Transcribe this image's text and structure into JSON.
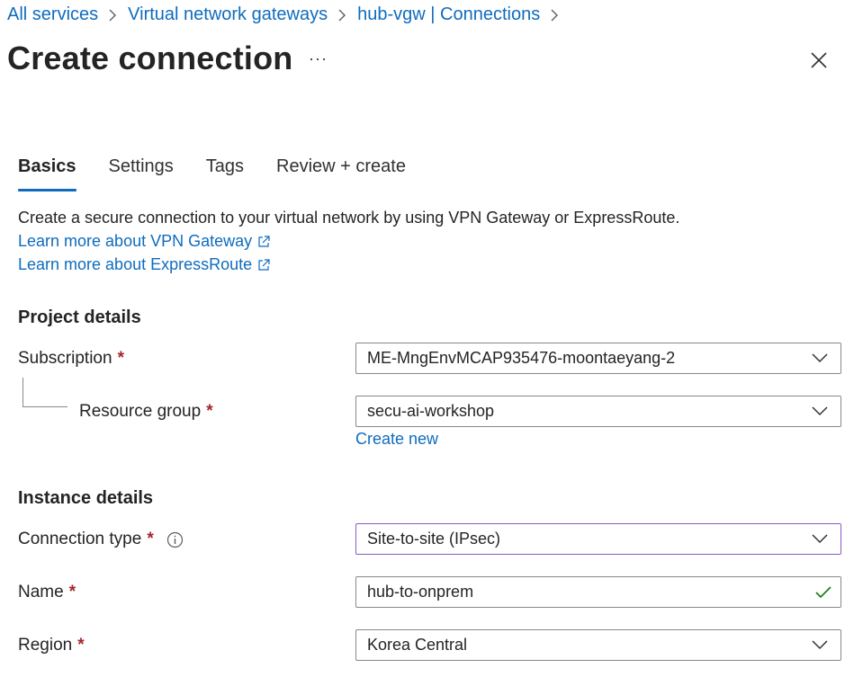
{
  "breadcrumb": [
    "All services",
    "Virtual network gateways",
    "hub-vgw | Connections"
  ],
  "title": "Create connection",
  "more_label": "···",
  "tabs": [
    {
      "label": "Basics",
      "active": true
    },
    {
      "label": "Settings",
      "active": false
    },
    {
      "label": "Tags",
      "active": false
    },
    {
      "label": "Review + create",
      "active": false
    }
  ],
  "intro": "Create a secure connection to your virtual network by using VPN Gateway or ExpressRoute.",
  "learn_vpn": "Learn more about VPN Gateway",
  "learn_er": "Learn more about ExpressRoute",
  "project": {
    "heading": "Project details",
    "subscription_label": "Subscription",
    "subscription_value": "ME-MngEnvMCAP935476-moontaeyang-2",
    "rg_label": "Resource group",
    "rg_value": "secu-ai-workshop",
    "create_new": "Create new"
  },
  "instance": {
    "heading": "Instance details",
    "conn_type_label": "Connection type",
    "conn_type_value": "Site-to-site (IPsec)",
    "name_label": "Name",
    "name_value": "hub-to-onprem",
    "region_label": "Region",
    "region_value": "Korea Central"
  },
  "required_mark": "*",
  "colors": {
    "accent": "#0f6cbd",
    "required": "#a4262c",
    "valid": "#107c10",
    "focus": "#8a5ac7"
  }
}
